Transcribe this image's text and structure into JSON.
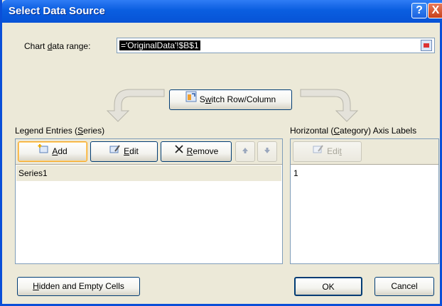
{
  "window": {
    "title": "Select Data Source",
    "help_icon": "?",
    "close_icon": "X"
  },
  "range": {
    "label_pre": "Chart ",
    "label_access": "d",
    "label_post": "ata range:",
    "value": "='OriginalData'!$B$1"
  },
  "switch_button": {
    "access": "w",
    "label_pre": "S",
    "label_post": "itch Row/Column"
  },
  "legend": {
    "title_pre": "Legend Entries (",
    "title_access": "S",
    "title_post": "eries)",
    "add_label": "Add",
    "add_access": "A",
    "add_rest": "dd",
    "edit_access": "E",
    "edit_rest": "dit",
    "remove_access": "R",
    "remove_rest": "emove",
    "items": [
      "Series1"
    ]
  },
  "axis": {
    "title_pre": "Horizontal (",
    "title_access": "C",
    "title_post": "ategory) Axis Labels",
    "edit_pre": "Edi",
    "edit_access": "t",
    "items": [
      "1"
    ]
  },
  "footer": {
    "hidden_access": "H",
    "hidden_rest": "idden and Empty Cells",
    "ok_label": "OK",
    "cancel_label": "Cancel"
  },
  "colors": {
    "title_bar": "#0a5ee0",
    "dialog_bg": "#ece9d8",
    "selection": "#000000"
  },
  "icons": {
    "add": "add-series-icon",
    "edit": "edit-icon",
    "remove": "remove-x-icon",
    "up": "move-up-icon",
    "down": "move-down-icon",
    "switch": "switch-row-column-icon",
    "collapse": "collapse-dialog-icon"
  }
}
